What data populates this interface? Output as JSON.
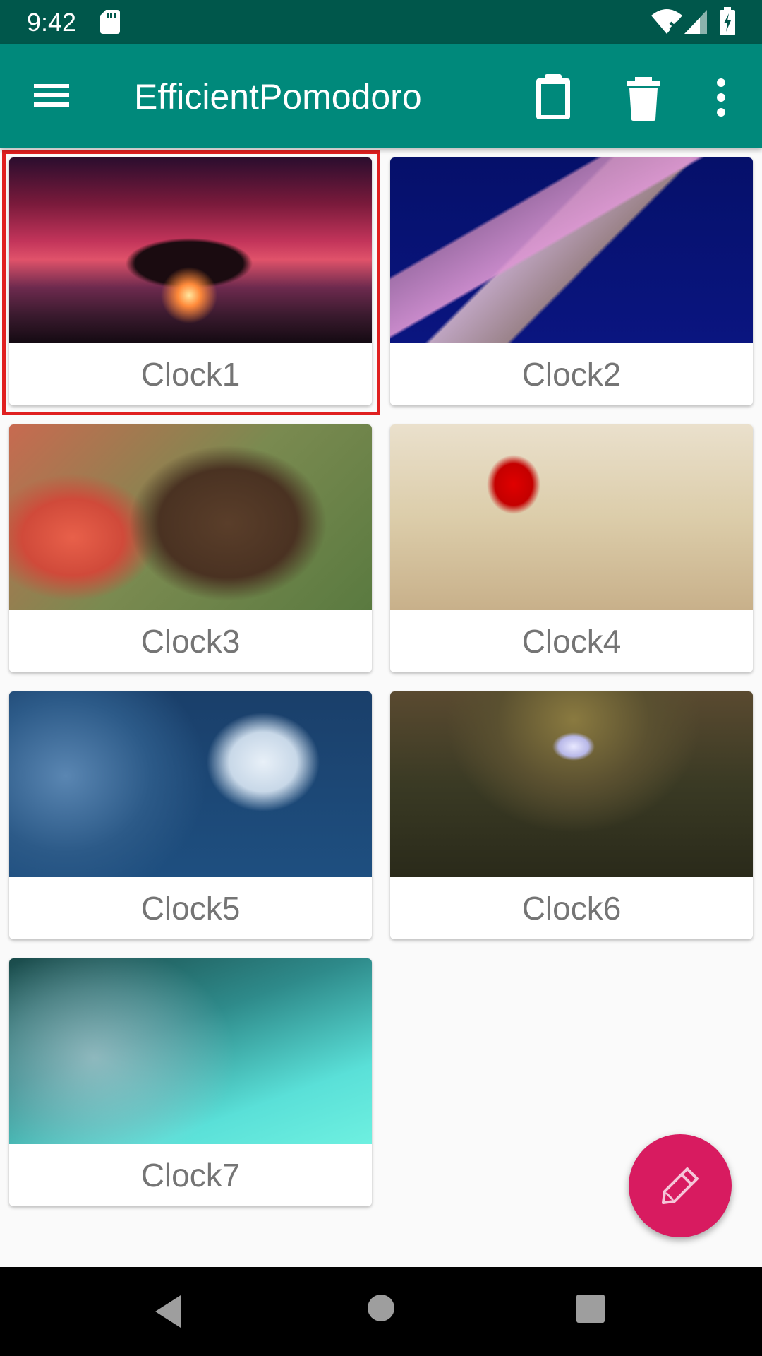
{
  "status_bar": {
    "time": "9:42"
  },
  "app_bar": {
    "title": "EfficientPomodoro",
    "icons": [
      "menu-icon",
      "clipboard-icon",
      "delete-icon",
      "more-vert-icon"
    ]
  },
  "cards": [
    {
      "label": "Clock1",
      "selected": true
    },
    {
      "label": "Clock2",
      "selected": false
    },
    {
      "label": "Clock3",
      "selected": false
    },
    {
      "label": "Clock4",
      "selected": false
    },
    {
      "label": "Clock5",
      "selected": false
    },
    {
      "label": "Clock6",
      "selected": false
    },
    {
      "label": "Clock7",
      "selected": false
    }
  ],
  "colors": {
    "status_bar": "#00574b",
    "app_bar": "#00897b",
    "fab": "#d81b60",
    "selection": "#e02020",
    "card_label": "#757575"
  },
  "fab": {
    "icon": "pencil-icon"
  }
}
